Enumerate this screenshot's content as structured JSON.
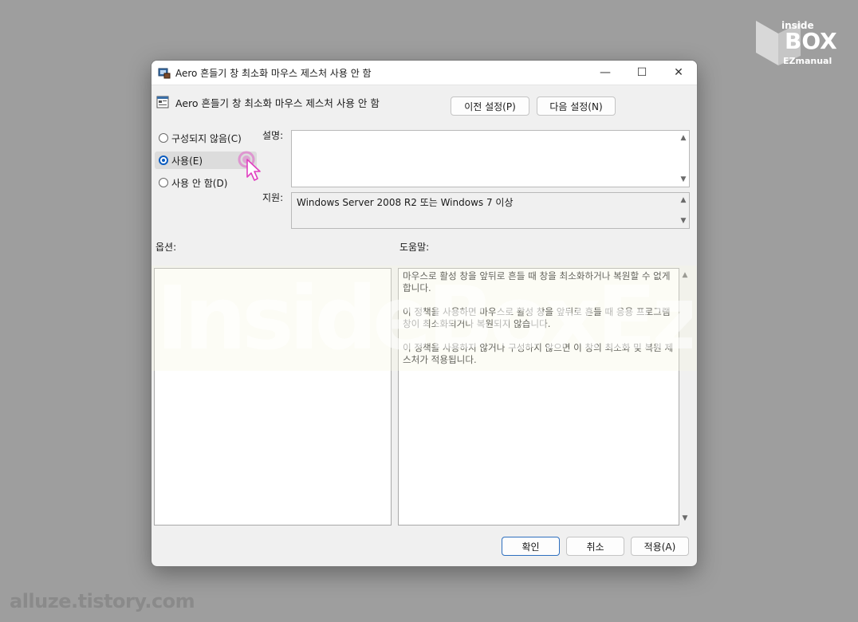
{
  "window": {
    "title": "Aero 흔들기 창 최소화 마우스 제스처 사용 안 함",
    "controls": {
      "minimize": "—",
      "maximize": "☐",
      "close": "✕"
    }
  },
  "header": {
    "policy_title": "Aero 흔들기 창 최소화 마우스 제스처 사용 안 함",
    "prev_button": "이전 설정(P)",
    "next_button": "다음 설정(N)"
  },
  "state": {
    "options": [
      {
        "label": "구성되지 않음(C)",
        "selected": false
      },
      {
        "label": "사용(E)",
        "selected": true
      },
      {
        "label": "사용 안 함(D)",
        "selected": false
      }
    ]
  },
  "fields": {
    "description_label": "설명:",
    "description_value": "",
    "support_label": "지원:",
    "support_value": "Windows Server 2008 R2 또는 Windows 7 이상"
  },
  "sections": {
    "options_label": "옵션:",
    "help_label": "도움말:",
    "help_paragraphs": [
      "마우스로 활성 창을 앞뒤로 흔들 때 창을 최소화하거나 복원할 수 없게 합니다.",
      "이 정책을 사용하면 마우스로 활성 창을 앞뒤로 흔들 때 응용 프로그램 창이 최소화되거나 복원되지 않습니다.",
      "이 정책을 사용하지 않거나 구성하지 않으면 이 창의 최소화 및 복원 제스처가 적용됩니다."
    ]
  },
  "footer": {
    "ok": "확인",
    "cancel": "취소",
    "apply": "적용(A)"
  },
  "watermarks": {
    "logo_line1": "inside",
    "logo_line2": "BOX",
    "logo_line3": "EZmanual",
    "band_text": "InsideBoxEzmanual",
    "footer_text": "alluze.tistory.com"
  },
  "colors": {
    "accent": "#0b5cc0",
    "cursor_ring": "#e040c0",
    "desktop": "#9e9e9e"
  },
  "icons": {
    "app": "group-policy-icon",
    "policy": "policy-setting-icon",
    "cursor": "mouse-pointer-icon"
  }
}
